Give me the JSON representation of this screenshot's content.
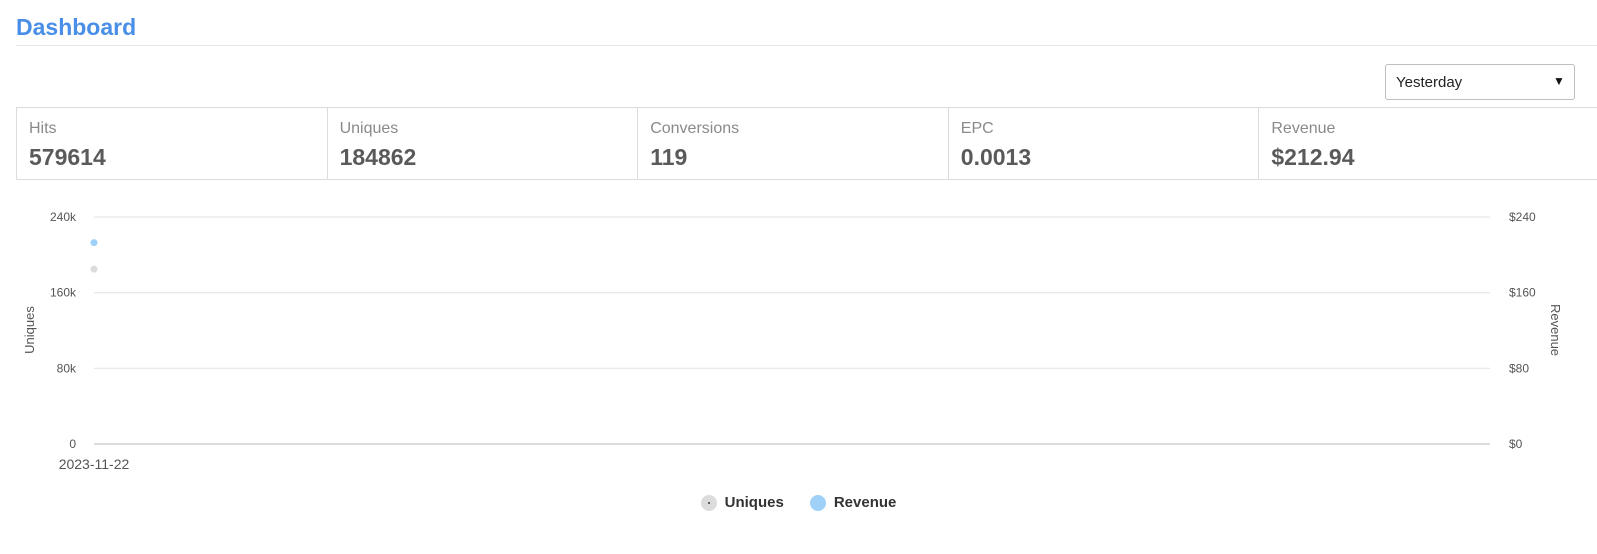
{
  "header": {
    "title": "Dashboard"
  },
  "filter": {
    "period_label": "Yesterday",
    "caret": "▼"
  },
  "stats": [
    {
      "label": "Hits",
      "value": "579614"
    },
    {
      "label": "Uniques",
      "value": "184862"
    },
    {
      "label": "Conversions",
      "value": "119"
    },
    {
      "label": "EPC",
      "value": "0.0013"
    },
    {
      "label": "Revenue",
      "value": "$212.94"
    }
  ],
  "legend": [
    {
      "label": "Uniques",
      "color": "#dcdcdc"
    },
    {
      "label": "Revenue",
      "color": "#9fd0f7"
    }
  ],
  "chart_data": {
    "type": "scatter",
    "x": [
      "2023-11-22"
    ],
    "series": [
      {
        "name": "Uniques",
        "axis": "left",
        "values": [
          184862
        ],
        "color": "#dcdcdc"
      },
      {
        "name": "Revenue",
        "axis": "right",
        "values": [
          212.94
        ],
        "color": "#9fd0f7"
      }
    ],
    "ylabel": "Uniques",
    "ylabel_right": "Revenue",
    "ylim": [
      0,
      240000
    ],
    "ylim_right": [
      0,
      240
    ],
    "yticks": [
      "0",
      "80k",
      "160k",
      "240k"
    ],
    "yticks_right": [
      "$0",
      "$80",
      "$160",
      "$240"
    ],
    "xticks": [
      "2023-11-22"
    ],
    "grid": true,
    "legend_position": "bottom"
  }
}
